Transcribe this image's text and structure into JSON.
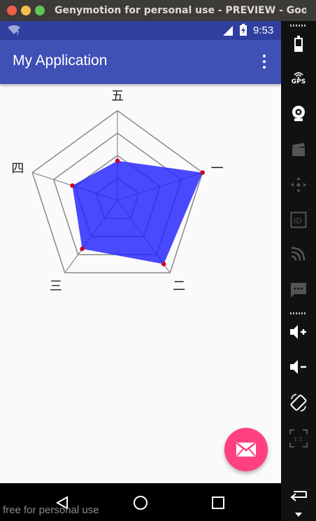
{
  "window": {
    "title": "Genymotion for personal use - PREVIEW - Google N"
  },
  "status_bar": {
    "time": "9:53"
  },
  "app_bar": {
    "title": "My Application"
  },
  "radar_chart": {
    "axis_labels": [
      "一",
      "二",
      "三",
      "四",
      "五"
    ]
  },
  "chart_data": {
    "type": "radar",
    "categories": [
      "一",
      "二",
      "三",
      "四",
      "五"
    ],
    "values": [
      1.0,
      0.88,
      0.67,
      0.53,
      0.44
    ],
    "rlim": [
      0,
      1
    ],
    "rings": 4,
    "fill_color": "#2222ff",
    "point_color": "#cc0022",
    "grid_color": "#888888"
  },
  "watermark": "free for personal use",
  "colors": {
    "primary": "#3f51b5",
    "primary_dark": "#303f9f",
    "accent": "#ff4081"
  },
  "toolbar": {
    "gps_label": "GPS",
    "id_label": "ID",
    "ratio_label": "1:1"
  }
}
